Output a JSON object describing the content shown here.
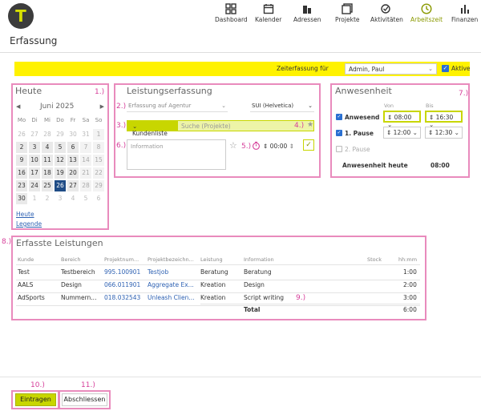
{
  "nav": {
    "items": [
      {
        "label": "Dashboard",
        "icon": "dashboard-icon"
      },
      {
        "label": "Kalender",
        "icon": "calendar-icon"
      },
      {
        "label": "Adressen",
        "icon": "buildings-icon"
      },
      {
        "label": "Projekte",
        "icon": "projects-icon"
      },
      {
        "label": "Aktivitäten",
        "icon": "activities-icon"
      },
      {
        "label": "Arbeitszeit",
        "icon": "clock-icon",
        "active": true
      },
      {
        "label": "Finanzen",
        "icon": "chart-icon"
      }
    ]
  },
  "logo_letter": "T",
  "page_title": "Erfassung",
  "zeiterfassung": {
    "label": "Zeiterfassung für",
    "selected_user": "Admin, Paul",
    "active_label": "Aktive"
  },
  "heute": {
    "title": "Heute",
    "marker": "1.)",
    "month": "Juni 2025",
    "weekdays": [
      "Mo",
      "Di",
      "Mi",
      "Do",
      "Fr",
      "Sa",
      "So"
    ],
    "weeks": [
      [
        "26",
        "27",
        "28",
        "29",
        "30",
        "31",
        "1"
      ],
      [
        "2",
        "3",
        "4",
        "5",
        "6",
        "7",
        "8"
      ],
      [
        "9",
        "10",
        "11",
        "12",
        "13",
        "14",
        "15"
      ],
      [
        "16",
        "17",
        "18",
        "19",
        "20",
        "21",
        "22"
      ],
      [
        "23",
        "24",
        "25",
        "26",
        "27",
        "28",
        "29"
      ],
      [
        "30",
        "1",
        "2",
        "3",
        "4",
        "5",
        "6"
      ]
    ],
    "today_link": "Heute",
    "legend_link": "Legende"
  },
  "leistung": {
    "title": "Leistungserfassung",
    "marker_2": "2.)",
    "marker_3": "3.)",
    "marker_4": "4.)",
    "marker_5": "5.)",
    "marker_6": "6.)",
    "erfassung_select": "Erfassung auf Agentur",
    "sui_select": "SUI (Helvetica)",
    "kundenliste_label": "Kundenliste",
    "search_placeholder": "Suche (Projekte)",
    "info_placeholder": "Information",
    "time_value": "00:00"
  },
  "anwesenheit": {
    "title": "Anwesenheit",
    "marker": "7.)",
    "von_label": "Von",
    "bis_label": "Bis",
    "rows": [
      {
        "label": "Anwesend",
        "checked": true,
        "von": "08:00",
        "bis": "16:30"
      },
      {
        "label": "1. Pause",
        "checked": true,
        "von": "12:00",
        "bis": "12:30"
      },
      {
        "label": "2. Pause",
        "checked": false
      }
    ],
    "heute_label": "Anwesenheit heute",
    "heute_value": "08:00"
  },
  "erfasste": {
    "title": "Erfasste Leistungen",
    "marker": "8.)",
    "marker_9": "9.)",
    "headers": [
      "Kunde",
      "Bereich",
      "Projektnum...",
      "Projektbezeichn...",
      "Leistung",
      "Information",
      "Stock",
      "hh:mm"
    ],
    "rows": [
      [
        "Test",
        "Testbereich",
        "995.100901",
        "Testjob",
        "Beratung",
        "Beratung",
        "",
        "1:00"
      ],
      [
        "AALS",
        "Design",
        "066.011901",
        "Aggregate Ex...",
        "Kreation",
        "Design",
        "",
        "2:00"
      ],
      [
        "AdSports",
        "Nummern...",
        "018.032543",
        "Unleash Clien...",
        "Kreation",
        "Script writing",
        "",
        "3:00"
      ]
    ],
    "total_label": "Total",
    "total_value": "6:00"
  },
  "footer": {
    "marker_10": "10.)",
    "marker_11": "11.)",
    "eintragen_label": "Eintragen",
    "abschliessen_label": "Abschliessen"
  }
}
